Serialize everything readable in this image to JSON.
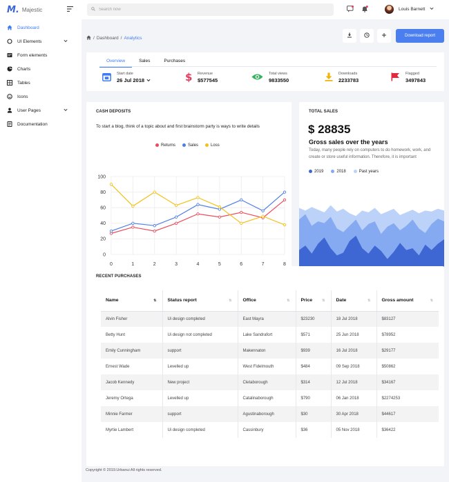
{
  "brand": {
    "name": "Majestic",
    "mark": "M."
  },
  "search": {
    "placeholder": "Search now"
  },
  "user": {
    "name": "Louis Barnett"
  },
  "sidebar": {
    "items": [
      {
        "label": "Dashboard",
        "icon": "home-icon",
        "active": true,
        "caret": false
      },
      {
        "label": "UI Elements",
        "icon": "circle-icon",
        "active": false,
        "caret": true
      },
      {
        "label": "Form elements",
        "icon": "form-icon",
        "active": false,
        "caret": false
      },
      {
        "label": "Charts",
        "icon": "pie-chart-icon",
        "active": false,
        "caret": false
      },
      {
        "label": "Tables",
        "icon": "grid-icon",
        "active": false,
        "caret": false
      },
      {
        "label": "Icons",
        "icon": "emoji-icon",
        "active": false,
        "caret": false
      },
      {
        "label": "User Pages",
        "icon": "user-icon",
        "active": false,
        "caret": true
      },
      {
        "label": "Documentation",
        "icon": "document-icon",
        "active": false,
        "caret": false
      }
    ]
  },
  "breadcrumb": {
    "items": [
      "Dashboard",
      "Analytics"
    ]
  },
  "actions": {
    "download_report": "Download report"
  },
  "overview": {
    "tabs": [
      "Overview",
      "Sales",
      "Purchases"
    ],
    "stats": [
      {
        "label": "Start date",
        "value": "26 Jul 2018",
        "icon": "calendar-icon",
        "color": "#3e7cf6"
      },
      {
        "label": "Revenue",
        "value": "$577545",
        "icon": "dollar-icon",
        "color": "#e53a5d"
      },
      {
        "label": "Total views",
        "value": "9833550",
        "icon": "eye-icon",
        "color": "#32b45c"
      },
      {
        "label": "Downloads",
        "value": "2233783",
        "icon": "download-icon",
        "color": "#f2b20b"
      },
      {
        "label": "Flagged",
        "value": "3497843",
        "icon": "flag-icon",
        "color": "#e5283d"
      }
    ]
  },
  "cash": {
    "title": "CASH DEPOSITS",
    "desc": "To start a blog, think of a topic about and first brainstorm party is ways to write details"
  },
  "chart_data": [
    {
      "type": "line",
      "x": [
        0,
        1,
        2,
        3,
        4,
        5,
        6,
        7,
        8
      ],
      "ylim": [
        0,
        100
      ],
      "yticks": [
        0,
        20,
        40,
        60,
        80,
        100
      ],
      "grid": true,
      "legend_position": "top",
      "series": [
        {
          "name": "Returns",
          "color": "#ec4b5b",
          "values": [
            27,
            35,
            30,
            40,
            52,
            48,
            54,
            47,
            70
          ]
        },
        {
          "name": "Sales",
          "color": "#4f7ee6",
          "values": [
            30,
            40,
            37,
            48,
            64,
            58,
            70,
            56,
            80
          ]
        },
        {
          "name": "Loss",
          "color": "#f2c21b",
          "values": [
            90,
            62,
            80,
            63,
            73,
            61,
            40,
            49,
            38
          ]
        }
      ]
    },
    {
      "type": "area",
      "legend_position": "top-left",
      "series": [
        {
          "name": "Past years",
          "color": "#bcd2f8",
          "values": [
            75,
            72,
            76,
            73,
            70,
            78,
            71,
            74,
            69,
            66,
            72,
            70,
            75,
            68,
            71,
            74,
            67,
            70,
            73,
            69,
            72,
            71,
            74,
            72
          ]
        },
        {
          "name": "2018",
          "color": "#86aaf1",
          "values": [
            62,
            68,
            55,
            60,
            58,
            65,
            52,
            48,
            55,
            62,
            50,
            57,
            60,
            46,
            54,
            58,
            50,
            55,
            62,
            52,
            47,
            57,
            63,
            60
          ]
        },
        {
          "name": "2019",
          "color": "#3f67d3",
          "values": [
            28,
            33,
            24,
            35,
            42,
            30,
            22,
            25,
            38,
            44,
            30,
            24,
            33,
            27,
            18,
            26,
            36,
            28,
            30,
            22,
            34,
            28,
            35,
            40
          ]
        }
      ]
    }
  ],
  "total_sales": {
    "title": "TOTAL SALES",
    "amount": "$ 28835",
    "subtitle": "Gross sales over the years",
    "desc": "Today, many people rely on computers to do homework, work, and create or store useful information. Therefore, it is important"
  },
  "recent": {
    "title": "RECENT PURCHASES",
    "columns": [
      "Name",
      "Status report",
      "Office",
      "Price",
      "Date",
      "Gross amount"
    ],
    "rows": [
      [
        "Alvin Fisher",
        "Ui design completed",
        "East Mayra",
        "$23230",
        "18 Jul 2018",
        "$83127"
      ],
      [
        "Betty Hunt",
        "Ui design not completed",
        "Lake Sandrafort",
        "$571",
        "25 Jun 2018",
        "$78952"
      ],
      [
        "Emily Cunningham",
        "support",
        "Makennaton",
        "$939",
        "16 Jul 2018",
        "$29177"
      ],
      [
        "Ernest Wade",
        "Levelled up",
        "West Fidelmouth",
        "$484",
        "09 Sep 2018",
        "$50862"
      ],
      [
        "Jacob Kennedy",
        "New project",
        "Cletaborough",
        "$314",
        "12 Jul 2018",
        "$34167"
      ],
      [
        "Jeremy Ortega",
        "Levelled up",
        "Catalinaborough",
        "$790",
        "06 Jan 2018",
        "$2274253"
      ],
      [
        "Minnie Farmer",
        "support",
        "Agustinaborough",
        "$30",
        "30 Apr 2018",
        "$44617"
      ],
      [
        "Myrtie Lambert",
        "Ui design completed",
        "Cassinbury",
        "$36",
        "05 Nov 2018",
        "$36422"
      ]
    ]
  },
  "footer": {
    "text": "Copyright © 2019.Urbanui All rights reserved."
  }
}
